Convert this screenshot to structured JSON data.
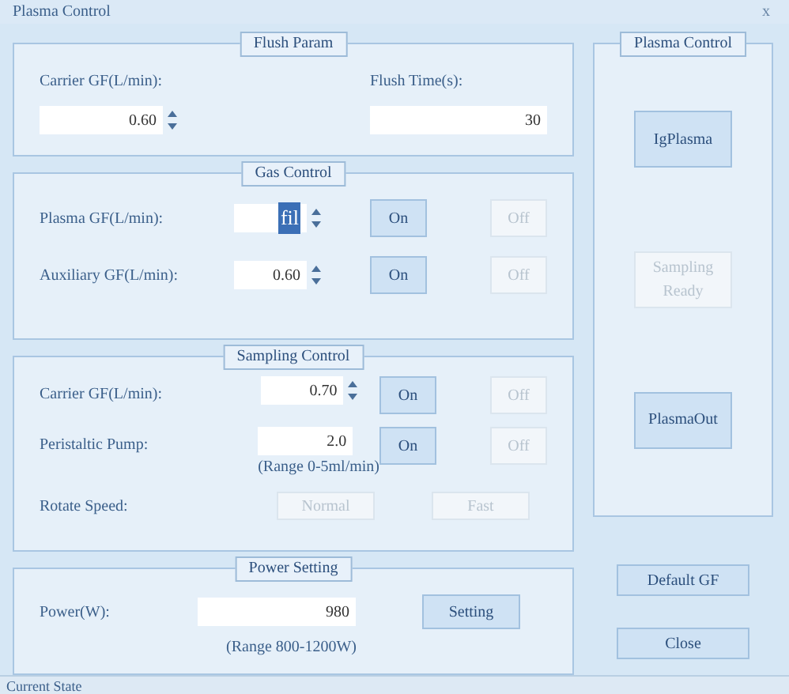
{
  "window": {
    "title": "Plasma Control",
    "close": "x"
  },
  "flush_param": {
    "legend": "Flush Param",
    "carrier": {
      "label": "Carrier GF(L/min):",
      "value": "0.60"
    },
    "flush_time": {
      "label": "Flush Time(s):",
      "value": "30"
    }
  },
  "gas_control": {
    "legend": "Gas Control",
    "rows": [
      {
        "label": "Plasma GF(L/min):",
        "value": "fil",
        "highlighted": true,
        "on": {
          "label": "On",
          "disabled": false
        },
        "off": {
          "label": "Off",
          "disabled": true
        }
      },
      {
        "label": "Auxiliary GF(L/min):",
        "value": "0.60",
        "highlighted": false,
        "on": {
          "label": "On",
          "disabled": false
        },
        "off": {
          "label": "Off",
          "disabled": true
        }
      }
    ]
  },
  "sampling_control": {
    "legend": "Sampling Control",
    "rows": [
      {
        "kind": "spin",
        "label": "Carrier GF(L/min):",
        "value": "0.70",
        "on": {
          "label": "On",
          "disabled": false
        },
        "off": {
          "label": "Off",
          "disabled": true
        }
      },
      {
        "kind": "pump",
        "label": "Peristaltic Pump:",
        "value": "2.0",
        "note": "(Range 0-5ml/min)",
        "on": {
          "label": "On",
          "disabled": false
        },
        "off": {
          "label": "Off",
          "disabled": true
        }
      },
      {
        "kind": "speed",
        "label": "Rotate Speed:",
        "buttons": [
          {
            "label": "Normal",
            "disabled": true
          },
          {
            "label": "Fast",
            "disabled": true
          }
        ]
      }
    ]
  },
  "power_setting": {
    "legend": "Power Setting",
    "label": "Power(W):",
    "value": "980",
    "button": "Setting",
    "note": "(Range 800-1200W)"
  },
  "plasma_control": {
    "legend": "Plasma Control",
    "buttons": [
      {
        "label": "IgPlasma",
        "disabled": false
      },
      {
        "label": "Sampling Ready",
        "disabled": true
      },
      {
        "label": "PlasmaOut",
        "disabled": false
      }
    ]
  },
  "default_button": "Default GF",
  "close_button": "Close",
  "status_bar": "Current State"
}
